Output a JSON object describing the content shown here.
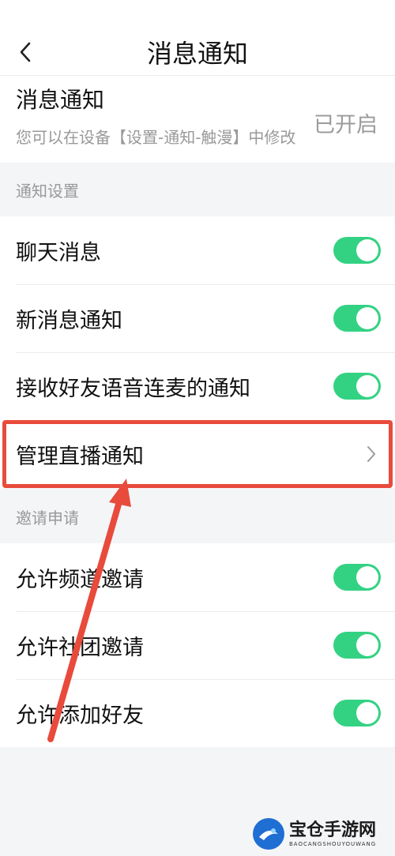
{
  "header": {
    "title": "消息通知"
  },
  "system_notification": {
    "title": "消息通知",
    "description": "您可以在设备【设置-通知-触漫】中修改",
    "status": "已开启"
  },
  "sections": {
    "notify_settings": {
      "header": "通知设置",
      "items": [
        {
          "label": "聊天消息",
          "enabled": true
        },
        {
          "label": "新消息通知",
          "enabled": true
        },
        {
          "label": "接收好友语音连麦的通知",
          "enabled": true
        },
        {
          "label": "管理直播通知"
        }
      ]
    },
    "invites": {
      "header": "邀请申请",
      "items": [
        {
          "label": "允许频道邀请",
          "enabled": true
        },
        {
          "label": "允许社团邀请",
          "enabled": true
        },
        {
          "label": "允许添加好友",
          "enabled": true
        }
      ]
    }
  },
  "watermark": {
    "name": "宝仓手游网",
    "subtitle": "BAOCANGSHOUYOUWANG"
  },
  "colors": {
    "toggle_on": "#33d283",
    "annotation": "#e84b3c"
  }
}
